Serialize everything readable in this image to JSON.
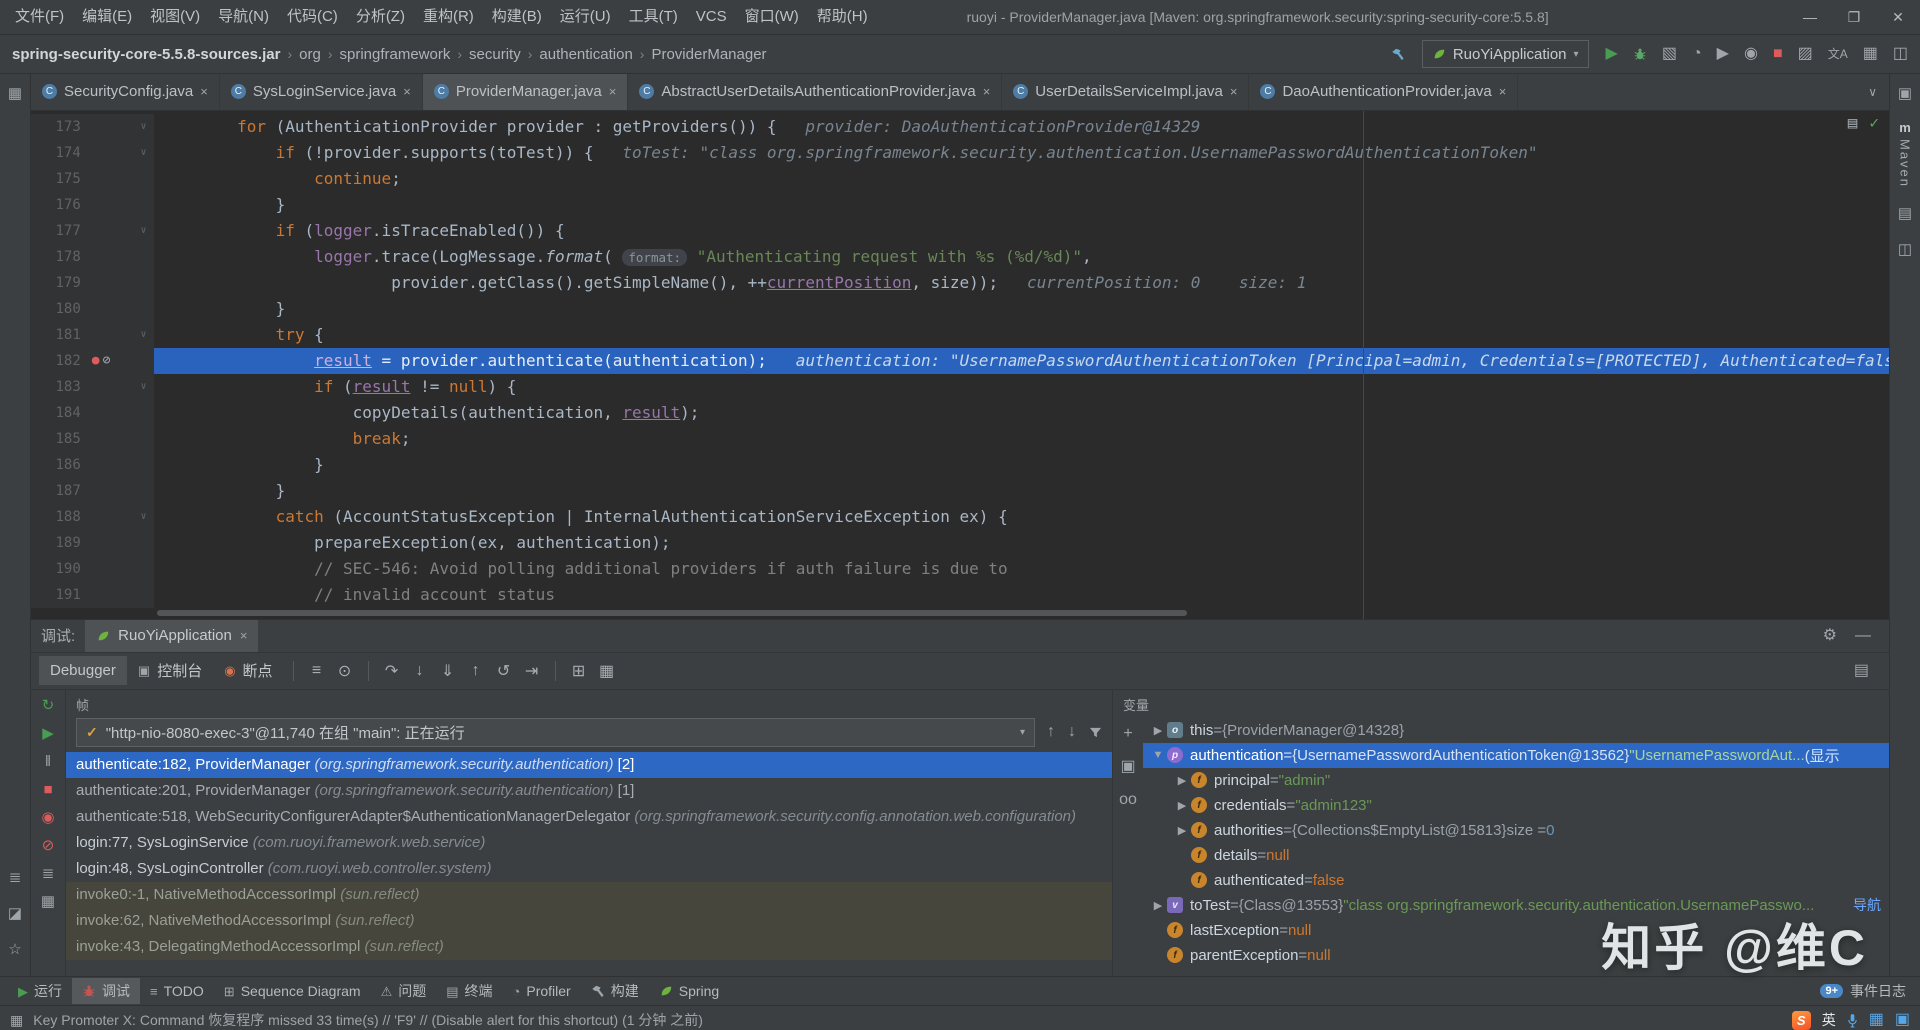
{
  "titlebar": {
    "menus": [
      "文件(F)",
      "编辑(E)",
      "视图(V)",
      "导航(N)",
      "代码(C)",
      "分析(Z)",
      "重构(R)",
      "构建(B)",
      "运行(U)",
      "工具(T)",
      "VCS",
      "窗口(W)",
      "帮助(H)"
    ],
    "title": "ruoyi - ProviderManager.java [Maven: org.springframework.security:spring-security-core:5.5.8]",
    "window_controls": [
      {
        "name": "minimize-button",
        "glyph": "—"
      },
      {
        "name": "maximize-button",
        "glyph": "❐"
      },
      {
        "name": "close-button",
        "glyph": "✕"
      }
    ]
  },
  "navbar": {
    "breadcrumbs": [
      "spring-security-core-5.5.8-sources.jar",
      "org",
      "springframework",
      "security",
      "authentication",
      "ProviderManager"
    ],
    "hammer": {
      "name": "build-hammer-icon",
      "svg": "hammer",
      "color": "#6aabc9"
    },
    "run_config": "RuoYiApplication",
    "icons": [
      {
        "name": "run-button",
        "glyph": "▶",
        "color": "#499c54"
      },
      {
        "name": "debug-button",
        "svg": "bug",
        "color": "#59a869"
      },
      {
        "name": "coverage-button",
        "glyph": "▧",
        "color": "#9fa6ab"
      },
      {
        "name": "profiler-button",
        "glyph": "◔",
        "color": "#9fa6ab"
      },
      {
        "name": "run-with-profiler-button",
        "glyph": "▶",
        "color": "#9fa6ab"
      },
      {
        "name": "attach-debugger-button",
        "glyph": "◉",
        "color": "#9fa6ab"
      },
      {
        "name": "stop-button",
        "glyph": "■",
        "color": "#db5c5c"
      },
      {
        "name": "window-tool-icon",
        "glyph": "▨",
        "color": "#9fa6ab"
      },
      {
        "name": "translate-icon",
        "glyph": "文A",
        "color": "#9fa6ab",
        "size": 12
      },
      {
        "name": "layout-grid-icon",
        "glyph": "▦",
        "color": "#9fa6ab"
      },
      {
        "name": "split-view-icon",
        "glyph": "◫",
        "color": "#9fa6ab"
      }
    ]
  },
  "left_strip": {
    "top_icons": [
      {
        "name": "project-tool-button",
        "glyph": "▦"
      }
    ],
    "bottom_icons": [
      {
        "name": "structure-tool-button",
        "glyph": "≣"
      },
      {
        "name": "bookmarks-tool-button",
        "glyph": "◪"
      },
      {
        "name": "favorites-tool-button",
        "glyph": "☆"
      }
    ]
  },
  "right_strip": {
    "top_icons": [
      {
        "name": "notifications-icon",
        "glyph": "▣"
      }
    ],
    "maven_label": "Maven",
    "maven_logo": "m",
    "bottom_icons": [
      {
        "name": "database-tool-button",
        "glyph": "▤"
      },
      {
        "name": "ant-tool-button",
        "glyph": "◫"
      }
    ]
  },
  "tabs": [
    {
      "label": "SecurityConfig.java",
      "active": false
    },
    {
      "label": "SysLoginService.java",
      "active": false
    },
    {
      "label": "ProviderManager.java",
      "active": true
    },
    {
      "label": "AbstractUserDetailsAuthenticationProvider.java",
      "active": false
    },
    {
      "label": "UserDetailsServiceImpl.java",
      "active": false
    },
    {
      "label": "DaoAuthenticationProvider.java",
      "active": false
    }
  ],
  "editor": {
    "top_icons": [
      {
        "name": "reader-mode-icon",
        "glyph": "▤",
        "color": "#9fa6ab"
      },
      {
        "name": "inspections-ok-icon",
        "glyph": "✓",
        "color": "#5caa5c"
      }
    ],
    "lines": [
      {
        "no": 173,
        "fold": true,
        "tokens": [
          [
            "def",
            "        "
          ],
          [
            "kw",
            "for"
          ],
          [
            "def",
            " (AuthenticationProvider provider : getProviders()) {"
          ],
          [
            "dbg",
            "   provider: DaoAuthenticationProvider@14329"
          ]
        ]
      },
      {
        "no": 174,
        "fold": true,
        "tokens": [
          [
            "def",
            "            "
          ],
          [
            "kw",
            "if"
          ],
          [
            "def",
            " (!provider.supports(toTest)) {"
          ],
          [
            "dbg",
            "   toTest: \"class org.springframework.security.authentication.UsernamePasswordAuthenticationToken\""
          ]
        ]
      },
      {
        "no": 175,
        "tokens": [
          [
            "def",
            "                "
          ],
          [
            "kw",
            "continue"
          ],
          [
            "def",
            ";"
          ]
        ]
      },
      {
        "no": 176,
        "tokens": [
          [
            "def",
            "            }"
          ]
        ]
      },
      {
        "no": 177,
        "fold": true,
        "tokens": [
          [
            "def",
            "            "
          ],
          [
            "kw",
            "if"
          ],
          [
            "def",
            " ("
          ],
          [
            "field",
            "logger"
          ],
          [
            "def",
            ".isTraceEnabled()) {"
          ]
        ]
      },
      {
        "no": 178,
        "tokens": [
          [
            "def",
            "                "
          ],
          [
            "field",
            "logger"
          ],
          [
            "def",
            ".trace(LogMessage."
          ],
          [
            "meth",
            "format"
          ],
          [
            "def",
            "( "
          ],
          [
            "hint",
            "format:"
          ],
          [
            "str",
            " \"Authenticating request with %s (%d/%d)\""
          ],
          [
            "def",
            ","
          ]
        ]
      },
      {
        "no": 179,
        "tokens": [
          [
            "def",
            "                        provider.getClass().getSimpleName(), ++"
          ],
          [
            "fieldu",
            "currentPosition"
          ],
          [
            "def",
            ", size));"
          ],
          [
            "dbg",
            "   currentPosition: 0    size: 1"
          ]
        ]
      },
      {
        "no": 180,
        "tokens": [
          [
            "def",
            "            }"
          ]
        ]
      },
      {
        "no": 181,
        "fold": true,
        "tokens": [
          [
            "def",
            "            "
          ],
          [
            "kw",
            "try"
          ],
          [
            "def",
            " {"
          ]
        ]
      },
      {
        "no": 182,
        "bp": true,
        "exec": true,
        "tokens": [
          [
            "def",
            "                "
          ],
          [
            "fieldu",
            "result"
          ],
          [
            "def",
            " = provider.authenticate(authentication);"
          ],
          [
            "dbg",
            "   authentication: \"UsernamePasswordAuthenticationToken [Principal=admin, Credentials=[PROTECTED], Authenticated=false, Granted Authorities=[]]\""
          ]
        ]
      },
      {
        "no": 183,
        "fold": true,
        "tokens": [
          [
            "def",
            "                "
          ],
          [
            "kw",
            "if"
          ],
          [
            "def",
            " ("
          ],
          [
            "fieldu",
            "result"
          ],
          [
            "def",
            " != "
          ],
          [
            "kw",
            "null"
          ],
          [
            "def",
            ") {"
          ]
        ]
      },
      {
        "no": 184,
        "tokens": [
          [
            "def",
            "                    copyDetails(authentication, "
          ],
          [
            "fieldu",
            "result"
          ],
          [
            "def",
            ");"
          ]
        ]
      },
      {
        "no": 185,
        "tokens": [
          [
            "def",
            "                    "
          ],
          [
            "kw",
            "break"
          ],
          [
            "def",
            ";"
          ]
        ]
      },
      {
        "no": 186,
        "tokens": [
          [
            "def",
            "                }"
          ]
        ]
      },
      {
        "no": 187,
        "tokens": [
          [
            "def",
            "            }"
          ]
        ]
      },
      {
        "no": 188,
        "fold": true,
        "tokens": [
          [
            "def",
            "            "
          ],
          [
            "kw",
            "catch"
          ],
          [
            "def",
            " (AccountStatusException | InternalAuthenticationServiceException ex) {"
          ]
        ]
      },
      {
        "no": 189,
        "tokens": [
          [
            "def",
            "                prepareException(ex, authentication);"
          ]
        ]
      },
      {
        "no": 190,
        "tokens": [
          [
            "def",
            "                "
          ],
          [
            "cmt",
            "// SEC-546: Avoid polling additional providers if auth failure is due to"
          ]
        ]
      },
      {
        "no": 191,
        "tokens": [
          [
            "def",
            "                "
          ],
          [
            "cmt",
            "// invalid account status"
          ]
        ]
      }
    ]
  },
  "debug": {
    "panel_label": "调试:",
    "session_tab": "RuoYiApplication",
    "view_tabs": [
      {
        "label": "Debugger",
        "active": true
      },
      {
        "label": "控制台",
        "icon": "▣",
        "icon_color": "#9fa6ab"
      },
      {
        "label": "断点",
        "icon": "◉",
        "icon_color": "#d9734c"
      }
    ],
    "step_icons": [
      {
        "name": "mute-renderers-button",
        "glyph": "≡"
      },
      {
        "name": "show-execution-point-button",
        "glyph": "⊙"
      },
      {
        "sep": true
      },
      {
        "name": "step-over-button",
        "glyph": "↷"
      },
      {
        "name": "step-into-button",
        "glyph": "↓"
      },
      {
        "name": "force-step-into-button",
        "glyph": "⇓"
      },
      {
        "name": "step-out-button",
        "glyph": "↑"
      },
      {
        "name": "drop-frame-button",
        "glyph": "↺"
      },
      {
        "name": "run-to-cursor-button",
        "glyph": "⇥"
      },
      {
        "sep": true
      },
      {
        "name": "evaluate-expression-button",
        "glyph": "⊞"
      },
      {
        "name": "trace-stream-button",
        "glyph": "▦"
      }
    ],
    "strip_right_icons": [
      {
        "name": "settings-gear-icon",
        "glyph": "⚙"
      },
      {
        "name": "hide-panel-icon",
        "glyph": "—"
      }
    ],
    "left_icons": [
      {
        "name": "rerun-button",
        "glyph": "↻",
        "color": "#499c54"
      },
      {
        "name": "resume-button",
        "glyph": "▶",
        "color": "#499c54"
      },
      {
        "name": "pause-button",
        "glyph": "‖",
        "color": "#9fa6ab"
      },
      {
        "name": "stop-button",
        "glyph": "■",
        "color": "#db5c5c"
      },
      {
        "name": "view-breakpoints-button",
        "glyph": "◉",
        "color": "#db5c5c"
      },
      {
        "name": "mute-breakpoints-button",
        "glyph": "⊘",
        "color": "#db5c5c"
      },
      {
        "name": "thread-dump-button",
        "glyph": "≣",
        "color": "#9fa6ab"
      },
      {
        "name": "layout-button",
        "glyph": "▦",
        "color": "#9fa6ab"
      }
    ],
    "frames": {
      "header": "帧",
      "thread": "\"http-nio-8080-exec-3\"@11,740 在组 \"main\": 正在运行",
      "thread_icons": [
        {
          "name": "previous-frame-button",
          "glyph": "↑"
        },
        {
          "name": "next-frame-button",
          "glyph": "↓"
        },
        {
          "name": "hide-library-frames-button",
          "svg": "funnel"
        }
      ],
      "rows": [
        {
          "cls": "sel",
          "loc": "authenticate:182, ProviderManager ",
          "pkg": "(org.springframework.security.authentication)",
          "suf": " [2]"
        },
        {
          "cls": "lib",
          "loc": "authenticate:201, ProviderManager ",
          "pkg": "(org.springframework.security.authentication)",
          "suf": " [1]"
        },
        {
          "cls": "lib",
          "loc": "authenticate:518, WebSecurityConfigurerAdapter$AuthenticationManagerDelegator ",
          "pkg": "(org.springframework.security.config.annotation.web.configuration)",
          "suf": ""
        },
        {
          "cls": "user",
          "loc": "login:77, SysLoginService ",
          "pkg": "(com.ruoyi.framework.web.service)",
          "suf": ""
        },
        {
          "cls": "user",
          "loc": "login:48, SysLoginController ",
          "pkg": "(com.ruoyi.web.controller.system)",
          "suf": ""
        },
        {
          "cls": "deep",
          "loc": "invoke0:-1, NativeMethodAccessorImpl ",
          "pkg": "(sun.reflect)",
          "suf": ""
        },
        {
          "cls": "deep",
          "loc": "invoke:62, NativeMethodAccessorImpl ",
          "pkg": "(sun.reflect)",
          "suf": ""
        },
        {
          "cls": "deep",
          "loc": "invoke:43, DelegatingMethodAccessorImpl ",
          "pkg": "(sun.reflect)",
          "suf": ""
        }
      ]
    },
    "variables": {
      "header": "变量",
      "tool_icons": [
        {
          "name": "add-watch-button",
          "glyph": "+"
        },
        {
          "name": "copy-value-button",
          "glyph": "▣"
        },
        {
          "name": "watches-glasses-icon",
          "glyph": "oo"
        }
      ],
      "rows": [
        {
          "indent": 0,
          "arrow": "r",
          "icon": "obj",
          "name": "this",
          "parts": [
            [
              "plain",
              " = "
            ],
            [
              "ref",
              "{ProviderManager@14328}"
            ]
          ]
        },
        {
          "indent": 0,
          "arrow": "d",
          "icon": "param",
          "sel": true,
          "name": "authentication",
          "parts": [
            [
              "plain",
              " = "
            ],
            [
              "ref",
              "{UsernamePasswordAuthenticationToken@13562} "
            ],
            [
              "str",
              "\"UsernamePasswordAut..."
            ],
            [
              "link",
              "(显示"
            ]
          ]
        },
        {
          "indent": 1,
          "arrow": "r",
          "icon": "field",
          "name": "principal",
          "parts": [
            [
              "plain",
              " = "
            ],
            [
              "str",
              "\"admin\""
            ]
          ]
        },
        {
          "indent": 1,
          "arrow": "r",
          "icon": "field",
          "name": "credentials",
          "parts": [
            [
              "plain",
              " = "
            ],
            [
              "str",
              "\"admin123\""
            ]
          ]
        },
        {
          "indent": 1,
          "arrow": "r",
          "icon": "field",
          "name": "authorities",
          "parts": [
            [
              "plain",
              " = "
            ],
            [
              "ref",
              "{Collections$EmptyList@15813} "
            ],
            [
              "dim",
              " size = "
            ],
            [
              "num",
              "0"
            ]
          ]
        },
        {
          "indent": 1,
          "arrow": "",
          "icon": "field",
          "name": "details",
          "parts": [
            [
              "plain",
              " = "
            ],
            [
              "kw",
              "null"
            ]
          ]
        },
        {
          "indent": 1,
          "arrow": "",
          "icon": "field",
          "name": "authenticated",
          "parts": [
            [
              "plain",
              " = "
            ],
            [
              "kw",
              "false"
            ]
          ]
        },
        {
          "indent": 0,
          "arrow": "r",
          "icon": "local",
          "name": "toTest",
          "parts": [
            [
              "plain",
              " = "
            ],
            [
              "ref",
              "{Class@13553} "
            ],
            [
              "str",
              "\"class org.springframework.security.authentication.UsernamePasswo..."
            ]
          ],
          "nav_link": "导航"
        },
        {
          "indent": 0,
          "arrow": "",
          "icon": "field",
          "name": "lastException",
          "parts": [
            [
              "plain",
              " = "
            ],
            [
              "kw",
              "null"
            ]
          ]
        },
        {
          "indent": 0,
          "arrow": "",
          "icon": "field",
          "name": "parentException",
          "parts": [
            [
              "plain",
              " = "
            ],
            [
              "kw",
              "null"
            ]
          ]
        }
      ]
    }
  },
  "bottombar": {
    "items": [
      {
        "name": "run-tool-button",
        "glyph": "▶",
        "color": "#499c54",
        "label": "运行"
      },
      {
        "name": "debug-tool-button",
        "svg": "bug",
        "color": "#c75450",
        "label": "调试",
        "active": true
      },
      {
        "name": "todo-tool-button",
        "glyph": "≡",
        "color": "#9fa6ab",
        "label": "TODO"
      },
      {
        "name": "sequence-diagram-tool-button",
        "glyph": "⊞",
        "color": "#9fa6ab",
        "label": "Sequence Diagram"
      },
      {
        "name": "problems-tool-button",
        "glyph": "⚠",
        "color": "#9fa6ab",
        "label": "问题"
      },
      {
        "name": "terminal-tool-button",
        "glyph": "▤",
        "color": "#9fa6ab",
        "label": "终端"
      },
      {
        "name": "profiler-tool-button",
        "glyph": "◔",
        "color": "#9fa6ab",
        "label": "Profiler"
      },
      {
        "name": "build-tool-button",
        "svg": "hammer",
        "color": "#9fa6ab",
        "label": "构建"
      },
      {
        "name": "spring-tool-button",
        "svg": "leaf",
        "label": "Spring"
      }
    ],
    "right": {
      "badge": "9+",
      "label": "事件日志"
    }
  },
  "statusbar": {
    "message": "Key Promoter X: Command 恢复程序 missed 33 time(s) // 'F9' // (Disable alert for this shortcut) (1 分钟 之前)",
    "right_icons": [
      {
        "name": "sogou-logo-icon",
        "sogou": true,
        "letter": "S"
      },
      {
        "name": "ime-mode-label",
        "ime": true,
        "text": "英"
      },
      {
        "name": "mic-icon",
        "svg": "mic"
      },
      {
        "name": "keyboard-icon",
        "glyph": "▦",
        "color": "#57a6e8"
      },
      {
        "name": "toolbox-icon",
        "glyph": "▣",
        "color": "#57a6e8"
      }
    ]
  },
  "watermark": "知乎 @维C"
}
